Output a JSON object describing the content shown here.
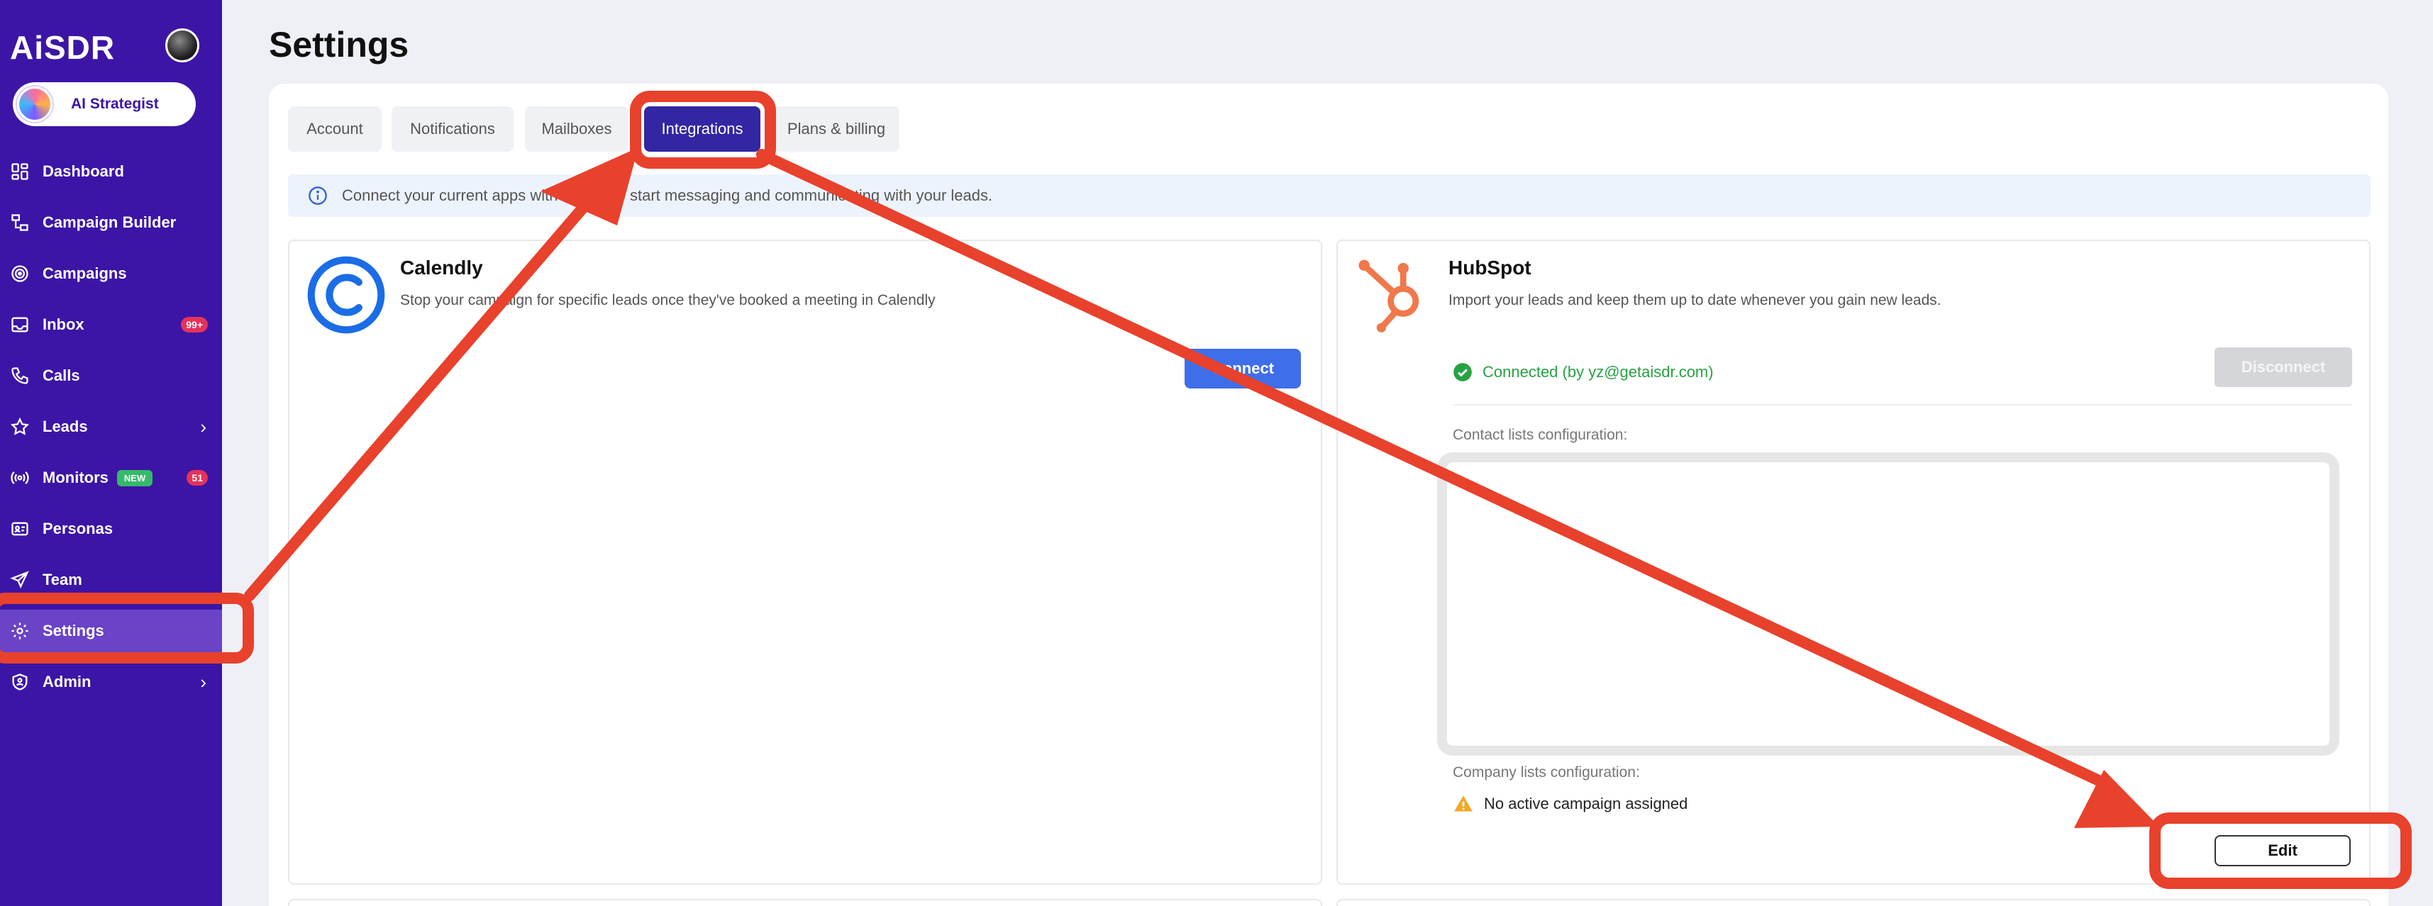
{
  "sidebar": {
    "logo": "AiSDR",
    "strategist_label": "AI Strategist",
    "items": [
      {
        "label": "Dashboard",
        "icon": "dashboard-icon"
      },
      {
        "label": "Campaign Builder",
        "icon": "campaign-builder-icon"
      },
      {
        "label": "Campaigns",
        "icon": "campaigns-icon"
      },
      {
        "label": "Inbox",
        "icon": "inbox-icon",
        "count": "99+"
      },
      {
        "label": "Calls",
        "icon": "phone-icon"
      },
      {
        "label": "Leads",
        "icon": "star-icon",
        "chevron": "›"
      },
      {
        "label": "Monitors",
        "icon": "broadcast-icon",
        "badge": "NEW",
        "count": "51"
      },
      {
        "label": "Personas",
        "icon": "id-card-icon"
      },
      {
        "label": "Team",
        "icon": "send-icon"
      },
      {
        "label": "Settings",
        "icon": "gear-icon",
        "active": true
      },
      {
        "label": "Admin",
        "icon": "shield-icon",
        "chevron": "›"
      }
    ]
  },
  "page": {
    "title": "Settings"
  },
  "tabs": [
    {
      "label": "Account"
    },
    {
      "label": "Notifications"
    },
    {
      "label": "Mailboxes"
    },
    {
      "label": "Integrations",
      "active": true
    },
    {
      "label": "Plans & billing"
    }
  ],
  "info_banner": {
    "text": "Connect your current apps with AiSDR to start messaging and communicating with your leads."
  },
  "calendly": {
    "title": "Calendly",
    "description": "Stop your campaign for specific leads once they've booked a meeting in Calendly",
    "connect_label": "Connect"
  },
  "hubspot": {
    "title": "HubSpot",
    "description": "Import your leads and keep them up to date whenever you gain new leads.",
    "status": "Connected (by yz@getaisdr.com)",
    "disconnect_label": "Disconnect",
    "contact_lists_label": "Contact lists configuration:",
    "company_lists_label": "Company lists configuration:",
    "warning_text": "No active campaign assigned",
    "edit_label": "Edit"
  },
  "colors": {
    "sidebar_bg": "#3c15a6",
    "active_tab": "#3326a3",
    "connect_button": "#3e6ee9",
    "annotation_red": "#e8412c",
    "connected_green": "#27a243"
  }
}
